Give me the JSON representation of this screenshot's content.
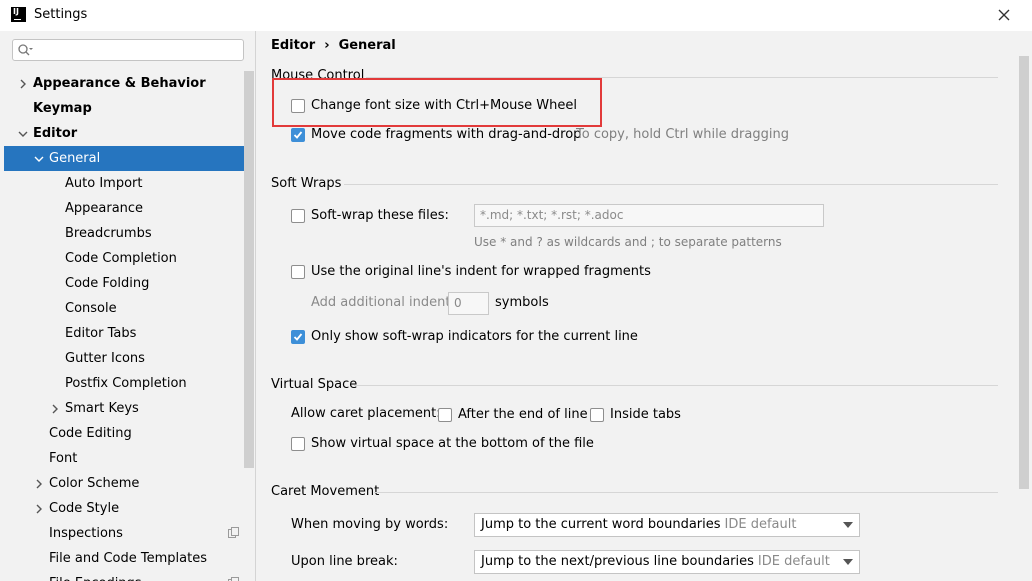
{
  "window": {
    "title": "Settings"
  },
  "sidebar": {
    "search_placeholder": "",
    "items": [
      {
        "label": "Appearance & Behavior"
      },
      {
        "label": "Keymap"
      },
      {
        "label": "Editor"
      },
      {
        "label": "General"
      },
      {
        "label": "Auto Import"
      },
      {
        "label": "Appearance"
      },
      {
        "label": "Breadcrumbs"
      },
      {
        "label": "Code Completion"
      },
      {
        "label": "Code Folding"
      },
      {
        "label": "Console"
      },
      {
        "label": "Editor Tabs"
      },
      {
        "label": "Gutter Icons"
      },
      {
        "label": "Postfix Completion"
      },
      {
        "label": "Smart Keys"
      },
      {
        "label": "Code Editing"
      },
      {
        "label": "Font"
      },
      {
        "label": "Color Scheme"
      },
      {
        "label": "Code Style"
      },
      {
        "label": "Inspections"
      },
      {
        "label": "File and Code Templates"
      },
      {
        "label": "File Encodings"
      }
    ]
  },
  "breadcrumb": {
    "part1": "Editor",
    "separator": "›",
    "part2": "General"
  },
  "mouse_control": {
    "title": "Mouse Control",
    "change_font_size": {
      "label": "Change font size with Ctrl+Mouse Wheel",
      "checked": false
    },
    "move_fragments": {
      "label": "Move code fragments with drag-and-drop",
      "checked": true,
      "hint": "To copy, hold Ctrl while dragging"
    }
  },
  "soft_wraps": {
    "title": "Soft Wraps",
    "soft_wrap_files": {
      "label": "Soft-wrap these files:",
      "checked": false,
      "value": "*.md; *.txt; *.rst; *.adoc",
      "hint": "Use * and ? as wildcards and ; to separate patterns"
    },
    "original_indent": {
      "label": "Use the original line's indent for wrapped fragments",
      "checked": false
    },
    "additional_indent": {
      "label": "Add additional indent:",
      "value": "0",
      "unit": "symbols"
    },
    "only_current_line": {
      "label": "Only show soft-wrap indicators for the current line",
      "checked": true
    }
  },
  "virtual_space": {
    "title": "Virtual Space",
    "caret_placement_label": "Allow caret placement:",
    "after_end_of_line": {
      "label": "After the end of line",
      "checked": false
    },
    "inside_tabs": {
      "label": "Inside tabs",
      "checked": false
    },
    "show_virtual_space": {
      "label": "Show virtual space at the bottom of the file",
      "checked": false
    }
  },
  "caret_movement": {
    "title": "Caret Movement",
    "moving_by_words": {
      "label": "When moving by words:",
      "value": "Jump to the current word boundaries",
      "default_note": "IDE default"
    },
    "line_break": {
      "label": "Upon line break:",
      "value": "Jump to the next/previous line boundaries",
      "default_note": "IDE default"
    }
  },
  "colors": {
    "accent": "#2675bf",
    "checkbox": "#3d8fd8",
    "highlight": "#e23a3a"
  }
}
